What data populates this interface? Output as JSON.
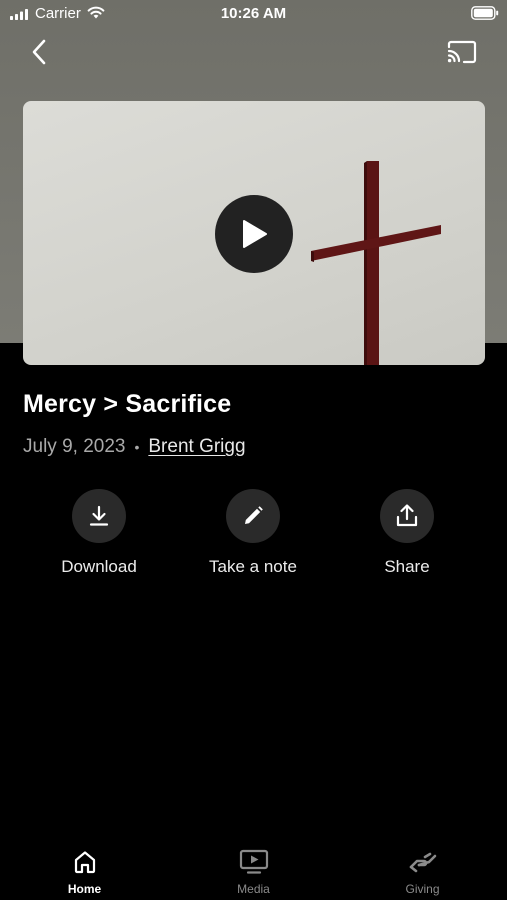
{
  "status_bar": {
    "carrier": "Carrier",
    "time": "10:26 AM"
  },
  "nav": {
    "back_icon": "chevron-left-icon",
    "cast_icon": "cast-icon"
  },
  "video": {
    "play_icon": "play-icon"
  },
  "sermon": {
    "title": "Mercy > Sacrifice",
    "date": "July 9, 2023",
    "separator": "•",
    "speaker": "Brent Grigg"
  },
  "actions": [
    {
      "label": "Download",
      "icon": "download-icon"
    },
    {
      "label": "Take a note",
      "icon": "pencil-icon"
    },
    {
      "label": "Share",
      "icon": "share-icon"
    }
  ],
  "tabs": [
    {
      "label": "Home",
      "icon": "home-icon",
      "active": true
    },
    {
      "label": "Media",
      "icon": "media-icon",
      "active": false
    },
    {
      "label": "Giving",
      "icon": "giving-icon",
      "active": false
    }
  ],
  "colors": {
    "hero_background": "#77776f",
    "page_background": "#000000",
    "cross": "#5a1414",
    "tab_active": "#ffffff",
    "tab_inactive": "#8a8a8a"
  }
}
